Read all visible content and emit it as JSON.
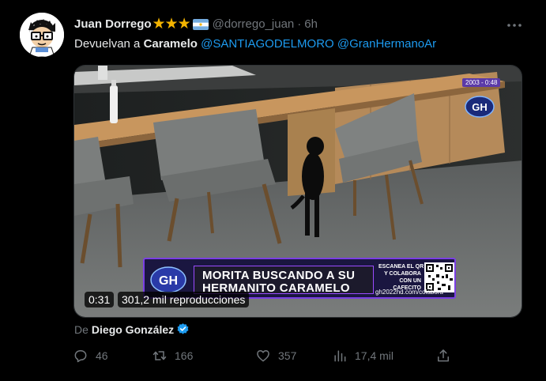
{
  "author": {
    "name": "Juan Dorrego",
    "stars": "★★★",
    "handle": "@dorrego_juan",
    "separator": "·",
    "time": "6h",
    "avatar_icon": "cartoon-avatar-icon",
    "flag_icon": "argentina-flag-icon"
  },
  "tweet": {
    "text_prefix": "Devuelvan a ",
    "text_bold": "Caramelo",
    "mention1": "@SANTIAGODELMORO",
    "mention2": "@GranHermanoAr"
  },
  "video": {
    "gh_date": "2003 - 0:48",
    "gh_logo_text": "GH",
    "ticker_line1": "MORITA BUSCANDO A SU",
    "ticker_line2": "HERMANITO CARAMELO",
    "scan_lines": [
      "ESCANEA EL QR",
      "Y COLABORA",
      "CON UN",
      "CAFECITO"
    ],
    "url": "gh2022hd.com/colabora",
    "duration": "0:31",
    "views": "301,2 mil reproducciones"
  },
  "credit": {
    "from": "De",
    "name": "Diego González"
  },
  "actions": {
    "replies": "46",
    "retweets": "166",
    "likes": "357",
    "views": "17,4 mil"
  },
  "colors": {
    "mention": "#1d9bf0",
    "muted": "#71767b",
    "star": "#f4b400",
    "ticker_border": "#7b3fe4"
  }
}
